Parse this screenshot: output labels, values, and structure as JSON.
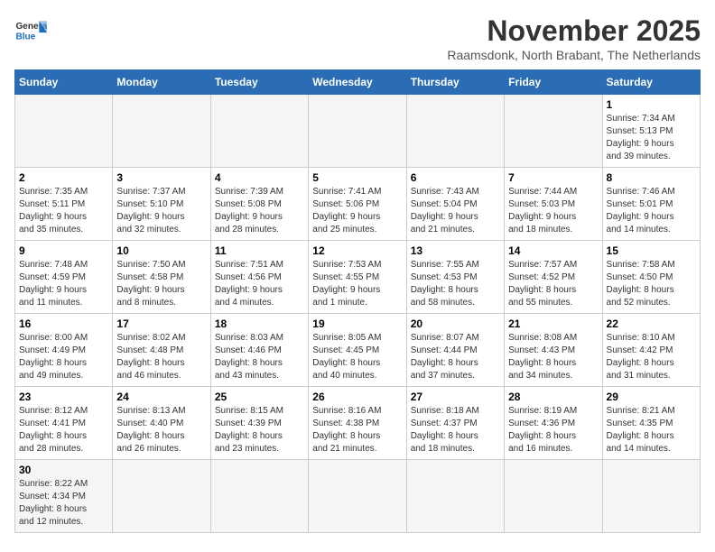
{
  "logo": {
    "text_general": "General",
    "text_blue": "Blue"
  },
  "title": "November 2025",
  "subtitle": "Raamsdonk, North Brabant, The Netherlands",
  "weekdays": [
    "Sunday",
    "Monday",
    "Tuesday",
    "Wednesday",
    "Thursday",
    "Friday",
    "Saturday"
  ],
  "weeks": [
    [
      {
        "day": "",
        "info": ""
      },
      {
        "day": "",
        "info": ""
      },
      {
        "day": "",
        "info": ""
      },
      {
        "day": "",
        "info": ""
      },
      {
        "day": "",
        "info": ""
      },
      {
        "day": "",
        "info": ""
      },
      {
        "day": "1",
        "info": "Sunrise: 7:34 AM\nSunset: 5:13 PM\nDaylight: 9 hours\nand 39 minutes."
      }
    ],
    [
      {
        "day": "2",
        "info": "Sunrise: 7:35 AM\nSunset: 5:11 PM\nDaylight: 9 hours\nand 35 minutes."
      },
      {
        "day": "3",
        "info": "Sunrise: 7:37 AM\nSunset: 5:10 PM\nDaylight: 9 hours\nand 32 minutes."
      },
      {
        "day": "4",
        "info": "Sunrise: 7:39 AM\nSunset: 5:08 PM\nDaylight: 9 hours\nand 28 minutes."
      },
      {
        "day": "5",
        "info": "Sunrise: 7:41 AM\nSunset: 5:06 PM\nDaylight: 9 hours\nand 25 minutes."
      },
      {
        "day": "6",
        "info": "Sunrise: 7:43 AM\nSunset: 5:04 PM\nDaylight: 9 hours\nand 21 minutes."
      },
      {
        "day": "7",
        "info": "Sunrise: 7:44 AM\nSunset: 5:03 PM\nDaylight: 9 hours\nand 18 minutes."
      },
      {
        "day": "8",
        "info": "Sunrise: 7:46 AM\nSunset: 5:01 PM\nDaylight: 9 hours\nand 14 minutes."
      }
    ],
    [
      {
        "day": "9",
        "info": "Sunrise: 7:48 AM\nSunset: 4:59 PM\nDaylight: 9 hours\nand 11 minutes."
      },
      {
        "day": "10",
        "info": "Sunrise: 7:50 AM\nSunset: 4:58 PM\nDaylight: 9 hours\nand 8 minutes."
      },
      {
        "day": "11",
        "info": "Sunrise: 7:51 AM\nSunset: 4:56 PM\nDaylight: 9 hours\nand 4 minutes."
      },
      {
        "day": "12",
        "info": "Sunrise: 7:53 AM\nSunset: 4:55 PM\nDaylight: 9 hours\nand 1 minute."
      },
      {
        "day": "13",
        "info": "Sunrise: 7:55 AM\nSunset: 4:53 PM\nDaylight: 8 hours\nand 58 minutes."
      },
      {
        "day": "14",
        "info": "Sunrise: 7:57 AM\nSunset: 4:52 PM\nDaylight: 8 hours\nand 55 minutes."
      },
      {
        "day": "15",
        "info": "Sunrise: 7:58 AM\nSunset: 4:50 PM\nDaylight: 8 hours\nand 52 minutes."
      }
    ],
    [
      {
        "day": "16",
        "info": "Sunrise: 8:00 AM\nSunset: 4:49 PM\nDaylight: 8 hours\nand 49 minutes."
      },
      {
        "day": "17",
        "info": "Sunrise: 8:02 AM\nSunset: 4:48 PM\nDaylight: 8 hours\nand 46 minutes."
      },
      {
        "day": "18",
        "info": "Sunrise: 8:03 AM\nSunset: 4:46 PM\nDaylight: 8 hours\nand 43 minutes."
      },
      {
        "day": "19",
        "info": "Sunrise: 8:05 AM\nSunset: 4:45 PM\nDaylight: 8 hours\nand 40 minutes."
      },
      {
        "day": "20",
        "info": "Sunrise: 8:07 AM\nSunset: 4:44 PM\nDaylight: 8 hours\nand 37 minutes."
      },
      {
        "day": "21",
        "info": "Sunrise: 8:08 AM\nSunset: 4:43 PM\nDaylight: 8 hours\nand 34 minutes."
      },
      {
        "day": "22",
        "info": "Sunrise: 8:10 AM\nSunset: 4:42 PM\nDaylight: 8 hours\nand 31 minutes."
      }
    ],
    [
      {
        "day": "23",
        "info": "Sunrise: 8:12 AM\nSunset: 4:41 PM\nDaylight: 8 hours\nand 28 minutes."
      },
      {
        "day": "24",
        "info": "Sunrise: 8:13 AM\nSunset: 4:40 PM\nDaylight: 8 hours\nand 26 minutes."
      },
      {
        "day": "25",
        "info": "Sunrise: 8:15 AM\nSunset: 4:39 PM\nDaylight: 8 hours\nand 23 minutes."
      },
      {
        "day": "26",
        "info": "Sunrise: 8:16 AM\nSunset: 4:38 PM\nDaylight: 8 hours\nand 21 minutes."
      },
      {
        "day": "27",
        "info": "Sunrise: 8:18 AM\nSunset: 4:37 PM\nDaylight: 8 hours\nand 18 minutes."
      },
      {
        "day": "28",
        "info": "Sunrise: 8:19 AM\nSunset: 4:36 PM\nDaylight: 8 hours\nand 16 minutes."
      },
      {
        "day": "29",
        "info": "Sunrise: 8:21 AM\nSunset: 4:35 PM\nDaylight: 8 hours\nand 14 minutes."
      }
    ],
    [
      {
        "day": "30",
        "info": "Sunrise: 8:22 AM\nSunset: 4:34 PM\nDaylight: 8 hours\nand 12 minutes."
      },
      {
        "day": "",
        "info": ""
      },
      {
        "day": "",
        "info": ""
      },
      {
        "day": "",
        "info": ""
      },
      {
        "day": "",
        "info": ""
      },
      {
        "day": "",
        "info": ""
      },
      {
        "day": "",
        "info": ""
      }
    ]
  ]
}
